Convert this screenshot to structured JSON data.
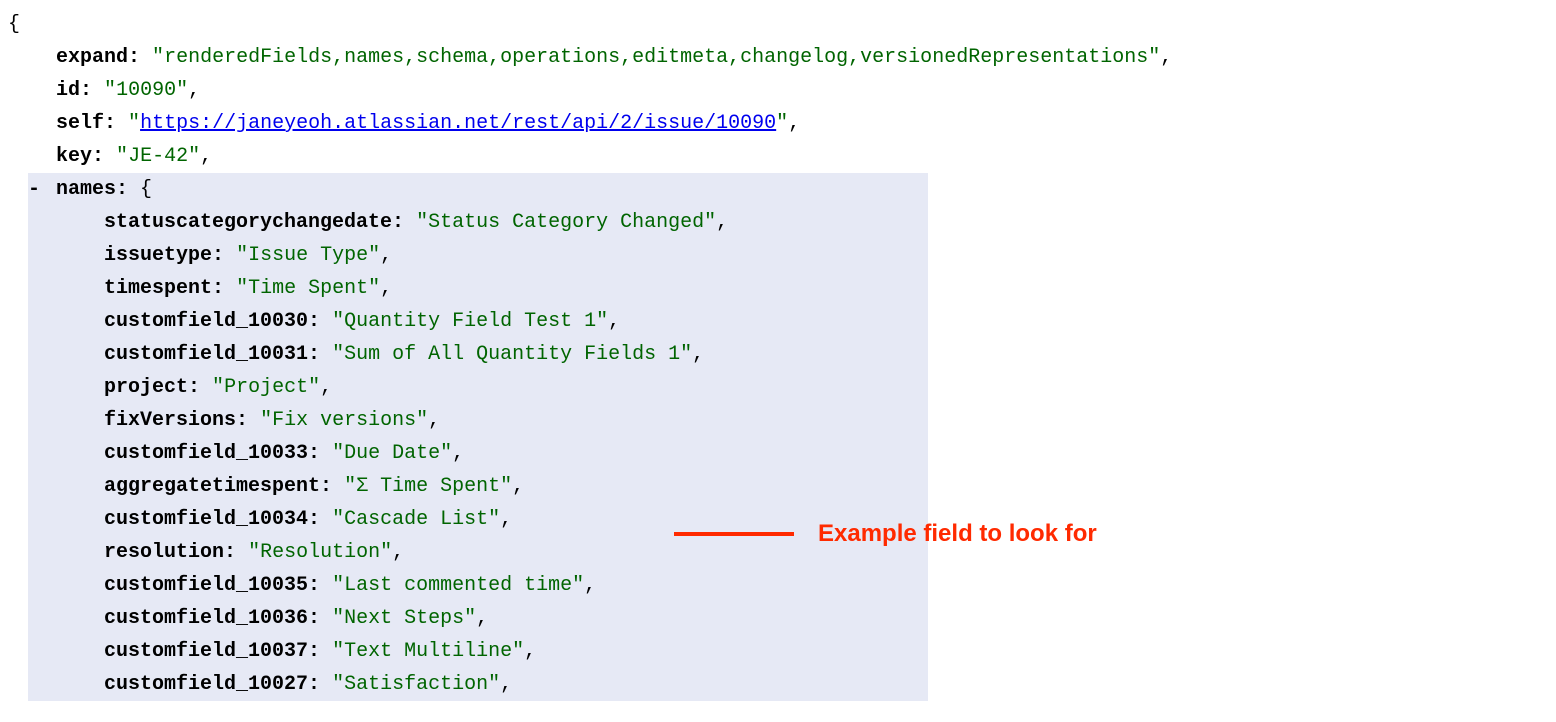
{
  "open_brace": "{",
  "root": {
    "expand": {
      "key": "expand",
      "value": "renderedFields,names,schema,operations,editmeta,changelog,versionedRepresentations"
    },
    "id": {
      "key": "id",
      "value": "10090"
    },
    "self": {
      "key": "self",
      "value": "https://janeyeoh.atlassian.net/rest/api/2/issue/10090"
    },
    "key": {
      "key": "key",
      "value": "JE-42"
    }
  },
  "names_key": "names",
  "collapse_symbol": "-",
  "open_brace_inner": "{",
  "names": [
    {
      "key": "statuscategorychangedate",
      "value": "Status Category Changed"
    },
    {
      "key": "issuetype",
      "value": "Issue Type"
    },
    {
      "key": "timespent",
      "value": "Time Spent"
    },
    {
      "key": "customfield_10030",
      "value": "Quantity Field Test 1"
    },
    {
      "key": "customfield_10031",
      "value": "Sum of All Quantity Fields 1"
    },
    {
      "key": "project",
      "value": "Project"
    },
    {
      "key": "fixVersions",
      "value": "Fix versions"
    },
    {
      "key": "customfield_10033",
      "value": "Due Date"
    },
    {
      "key": "aggregatetimespent",
      "value": "Σ Time Spent"
    },
    {
      "key": "customfield_10034",
      "value": "Cascade List"
    },
    {
      "key": "resolution",
      "value": "Resolution"
    },
    {
      "key": "customfield_10035",
      "value": "Last commented time"
    },
    {
      "key": "customfield_10036",
      "value": "Next Steps"
    },
    {
      "key": "customfield_10037",
      "value": "Text Multiline"
    },
    {
      "key": "customfield_10027",
      "value": "Satisfaction"
    }
  ],
  "annotation_text": "Example field to look for",
  "annotated_key": "customfield_10034"
}
